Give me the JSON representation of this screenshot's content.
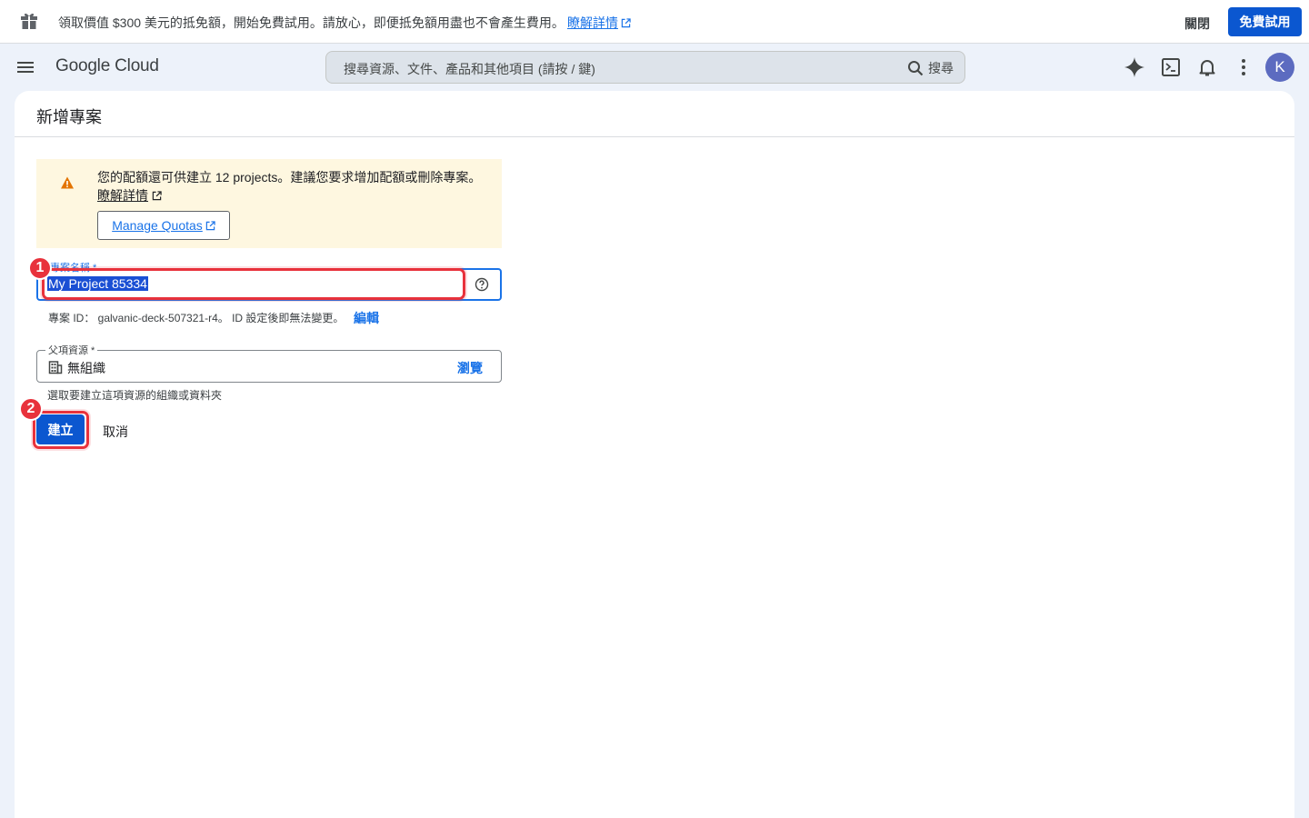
{
  "promo": {
    "text": "領取價值 $300 美元的抵免額，開始免費試用。請放心，即便抵免額用盡也不會產生費用。",
    "learn_more": "瞭解詳情",
    "dismiss": "關閉",
    "trial_button": "免費試用"
  },
  "appbar": {
    "logo": "Google Cloud",
    "search_placeholder": "搜尋資源、文件、產品和其他項目 (請按 / 鍵)",
    "search_button": "搜尋",
    "avatar_letter": "K"
  },
  "page": {
    "title": "新增專案",
    "alert": {
      "message": "您的配額還可供建立 12 projects。建議您要求增加配額或刪除專案。",
      "learn_more": "瞭解詳情",
      "manage_quotas": "Manage Quotas"
    },
    "project_name": {
      "label": "專案名稱 *",
      "value": "My Project 85334"
    },
    "project_id": {
      "text": "專案 ID： galvanic-deck-507321-r4。 ID 設定後即無法變更。",
      "edit": "編輯"
    },
    "parent": {
      "label": "父項資源 *",
      "value": "無組織",
      "browse": "瀏覽",
      "help": "選取要建立這項資源的組織或資料夾"
    },
    "create_button": "建立",
    "cancel_button": "取消"
  },
  "annotations": {
    "badge_1": "1",
    "badge_2": "2",
    "highlight_color": "#e8323c"
  },
  "colors": {
    "primary": "#0b57d0",
    "link": "#1a73e8",
    "alert_bg": "#fef7e0",
    "background": "#edf2fa"
  }
}
